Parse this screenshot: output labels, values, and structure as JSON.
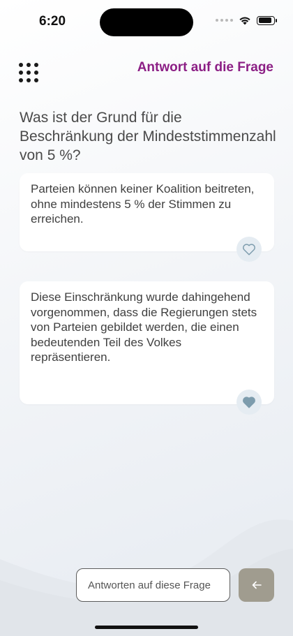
{
  "status_bar": {
    "time": "6:20"
  },
  "header": {
    "title": "Antwort auf die Frage"
  },
  "question": {
    "text": "Was ist der Grund für die Beschränkung der Mindeststimmenzahl von 5 %?"
  },
  "answers": [
    {
      "text": "Parteien können keiner Koalition beitreten, ohne mindestens 5 % der Stimmen zu erreichen.",
      "liked": false
    },
    {
      "text": "Diese Einschränkung wurde dahingehend vorgenommen, dass die Regierungen stets von Parteien gebildet werden, die einen bedeutenden Teil des Volkes repräsentieren.",
      "liked": true
    }
  ],
  "composer": {
    "placeholder": "Antworten auf diese Frage"
  },
  "colors": {
    "accent": "#8c1f85",
    "heart": "#7d9cad",
    "send_button": "#a09c8f"
  },
  "icons": {
    "menu": "grid-menu-icon",
    "heart": "heart-icon",
    "send": "arrow-left-icon"
  }
}
